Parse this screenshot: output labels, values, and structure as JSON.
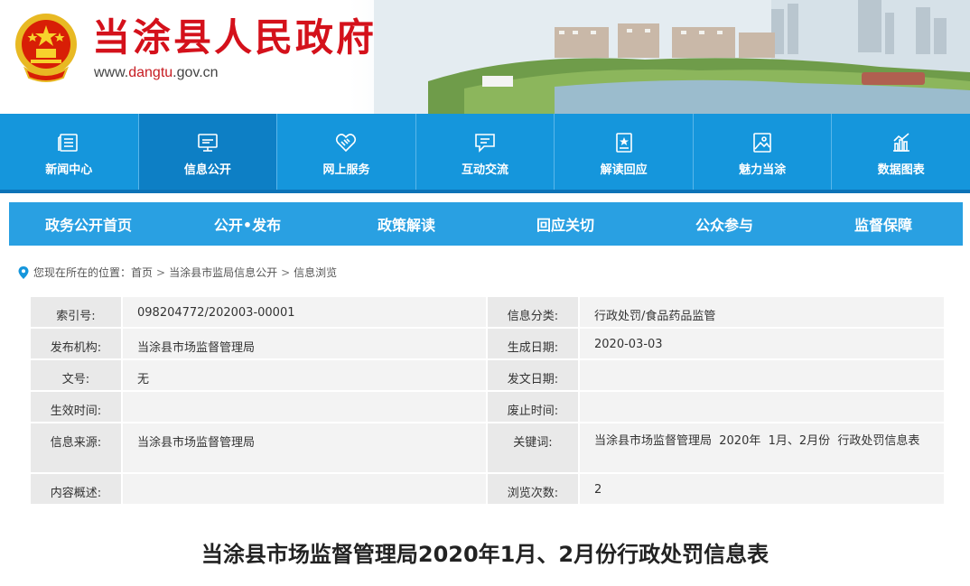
{
  "header": {
    "site_title": "当涂县人民政府",
    "url_prefix": "www.",
    "url_accent": "dangtu",
    "url_suffix": ".gov.cn"
  },
  "main_nav": [
    {
      "label": "新闻中心",
      "icon": "newspaper-icon"
    },
    {
      "label": "信息公开",
      "icon": "monitor-icon",
      "active": true
    },
    {
      "label": "网上服务",
      "icon": "handshake-icon"
    },
    {
      "label": "互动交流",
      "icon": "chat-bubble-icon"
    },
    {
      "label": "解读回应",
      "icon": "bookmark-icon"
    },
    {
      "label": "魅力当涂",
      "icon": "picture-icon"
    },
    {
      "label": "数据图表",
      "icon": "bar-chart-icon"
    }
  ],
  "sub_nav": [
    "政务公开首页",
    "公开•发布",
    "政策解读",
    "回应关切",
    "公众参与",
    "监督保障"
  ],
  "breadcrumb": {
    "prefix": "您现在所在的位置：",
    "items": [
      "首页",
      "当涂县市监局信息公开",
      "信息浏览"
    ],
    "separator": ">"
  },
  "info": {
    "index_no_label": "索引号:",
    "index_no": "098204772/202003-00001",
    "category_label": "信息分类:",
    "category": "行政处罚/食品药品监管",
    "publisher_label": "发布机构:",
    "publisher": "当涂县市场监督管理局",
    "created_label": "生成日期:",
    "created": "2020-03-03",
    "doc_no_label": "文号:",
    "doc_no": "无",
    "issue_date_label": "发文日期:",
    "issue_date": "",
    "effective_label": "生效时间:",
    "effective": "",
    "expiry_label": "废止时间:",
    "expiry": "",
    "source_label": "信息来源:",
    "source": "当涂县市场监督管理局",
    "keywords_label": "关键词:",
    "keywords": "当涂县市场监督管理局  2020年  1月、2月份  行政处罚信息表",
    "summary_label": "内容概述:",
    "summary": "",
    "views_label": "浏览次数:",
    "views": "2"
  },
  "doc_title": "当涂县市场监督管理局2020年1月、2月份行政处罚信息表",
  "colors": {
    "brand_red": "#d4111b",
    "nav_blue": "#1596dc",
    "nav_active": "#0d7fc5",
    "subnav_blue": "#29a0e2"
  }
}
